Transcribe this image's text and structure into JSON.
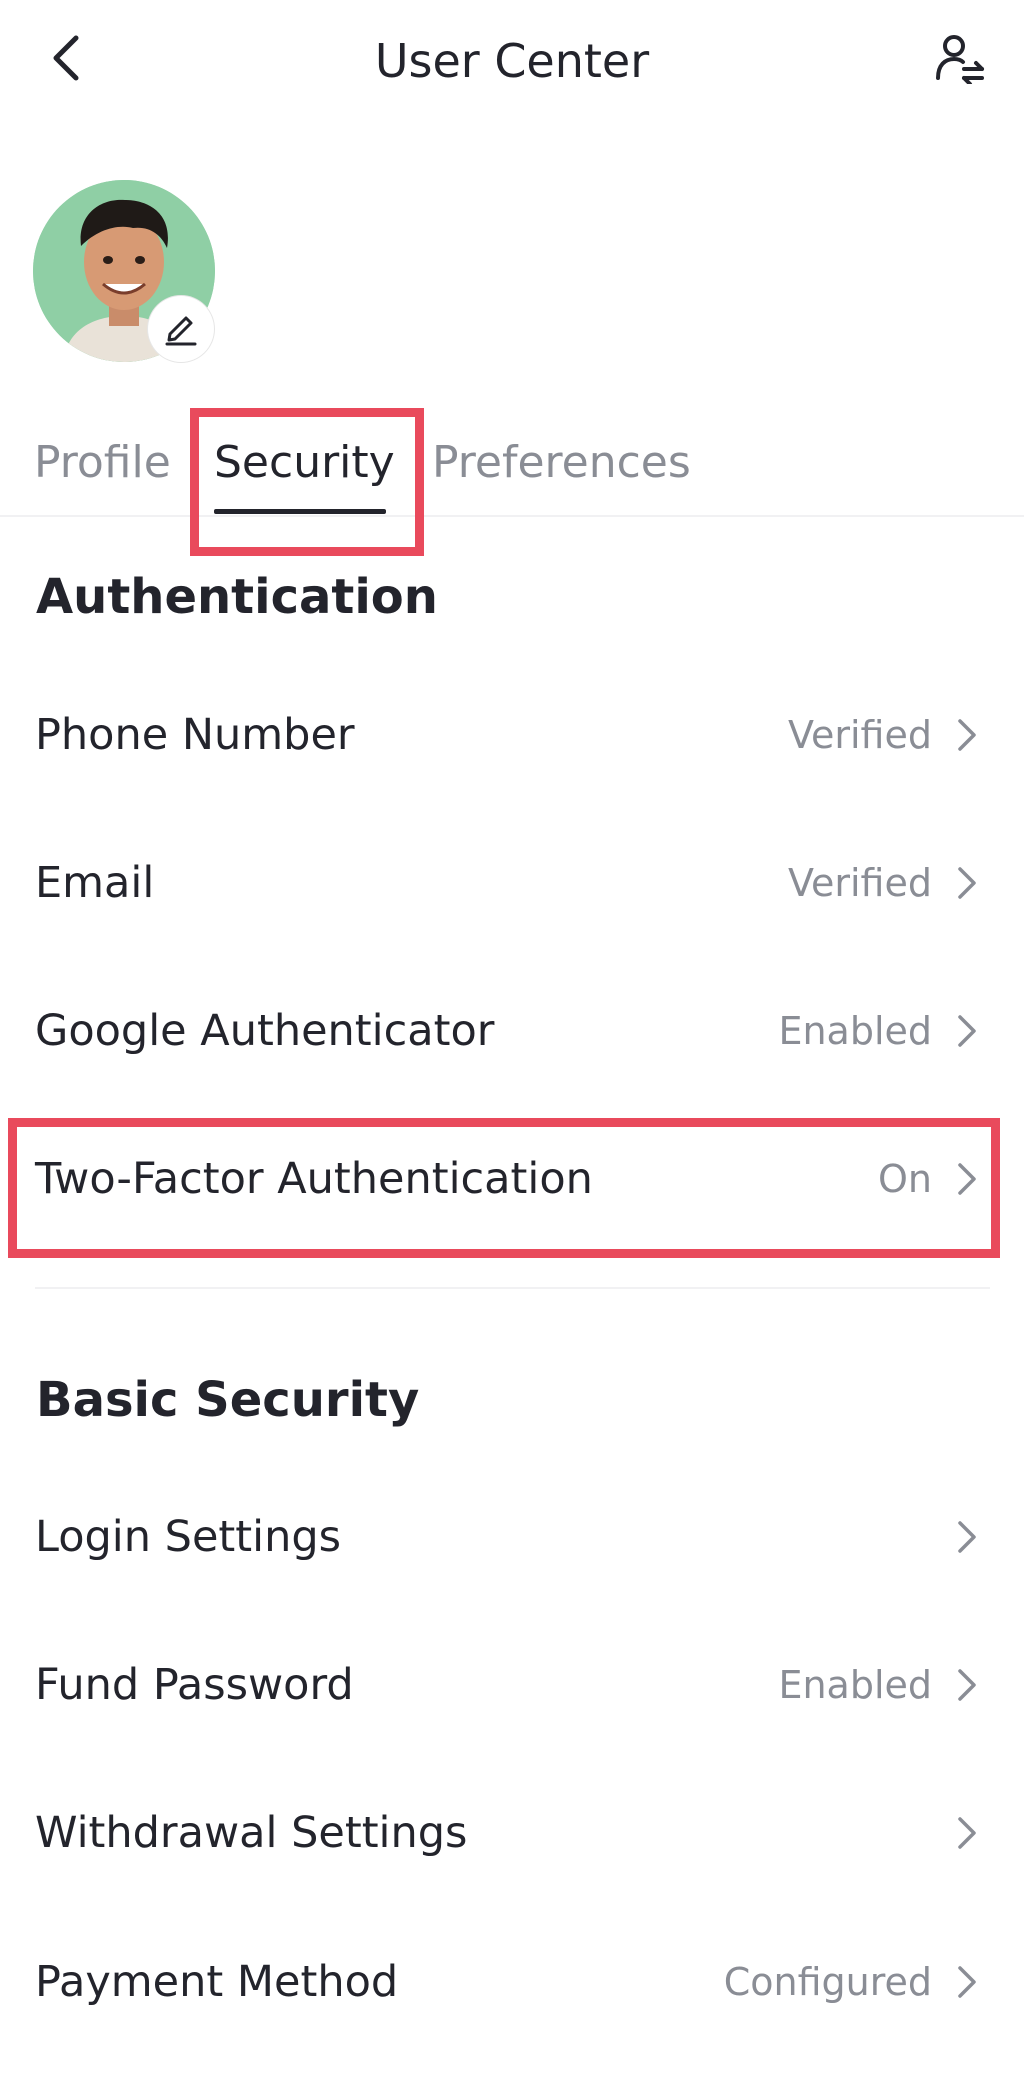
{
  "header": {
    "title": "User Center",
    "back_icon": "chevron-left-icon",
    "switch_account_icon": "user-switch-icon"
  },
  "profile": {
    "avatar_icon": "avatar",
    "edit_icon": "pencil-icon"
  },
  "tabs": [
    {
      "label": "Profile",
      "active": false
    },
    {
      "label": "Security",
      "active": true
    },
    {
      "label": "Preferences",
      "active": false
    }
  ],
  "sections": {
    "authentication": {
      "title": "Authentication",
      "items": [
        {
          "label": "Phone Number",
          "status": "Verified"
        },
        {
          "label": "Email",
          "status": "Verified"
        },
        {
          "label": "Google Authenticator",
          "status": "Enabled"
        },
        {
          "label": "Two-Factor Authentication",
          "status": "On"
        }
      ]
    },
    "basic_security": {
      "title": "Basic Security",
      "items": [
        {
          "label": "Login Settings",
          "status": ""
        },
        {
          "label": "Fund Password",
          "status": "Enabled"
        },
        {
          "label": "Withdrawal Settings",
          "status": ""
        },
        {
          "label": "Payment Method",
          "status": "Configured"
        }
      ]
    }
  },
  "colors": {
    "highlight": "#e94a5c",
    "text_primary": "#23242c",
    "text_secondary": "#8a8d95",
    "avatar_bg": "#8fcfa5"
  }
}
